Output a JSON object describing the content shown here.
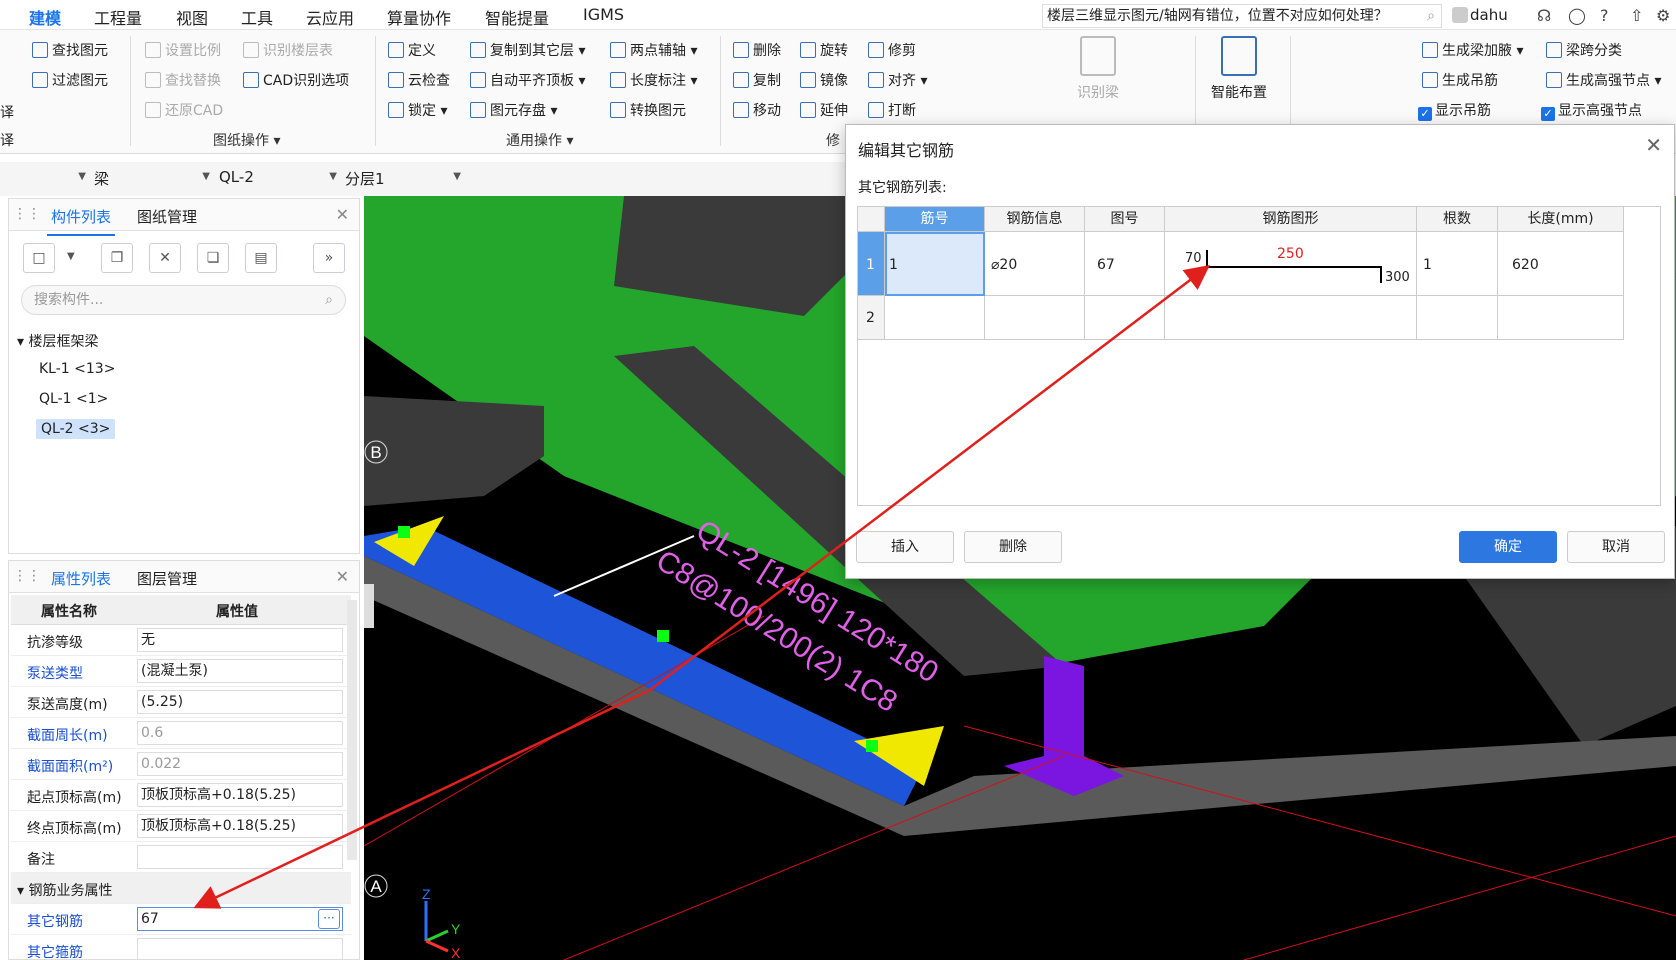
{
  "menu": {
    "items": [
      "建模",
      "工程量",
      "视图",
      "工具",
      "云应用",
      "算量协作",
      "智能提量",
      "IGMS"
    ],
    "active_index": 0,
    "question_text": "楼层三维显示图元/轴网有错位，位置不对应如何处理？",
    "user": "dahu"
  },
  "ribbon": {
    "left_cut": {
      "a": "译",
      "b": "译"
    },
    "g1": {
      "find": "查找图元",
      "filter": "过滤图元"
    },
    "g2": {
      "scale": "设置比例",
      "floor": "识别楼层表",
      "replace": "查找替换",
      "cad_opts": "CAD识别选项",
      "restore": "还原CAD",
      "label": "图纸操作"
    },
    "g3": {
      "define": "定义",
      "copy_to": "复制到其它层",
      "axis": "两点辅轴",
      "cloud_check": "云检查",
      "auto_flat": "自动平齐顶板",
      "length": "长度标注",
      "lock": "锁定",
      "store": "图元存盘",
      "convert": "转换图元",
      "label": "通用操作"
    },
    "g4": {
      "delete": "删除",
      "rotate": "旋转",
      "trim": "修剪",
      "copy": "复制",
      "mirror": "镜像",
      "align": "对齐",
      "move": "移动",
      "extend": "延伸",
      "break": "打断",
      "label": "修"
    },
    "g5": {
      "identify_beam": "识别梁",
      "smart_layout": "智能布置"
    },
    "g6": {
      "gen_haunch": "生成梁加腋",
      "span_class": "梁跨分类",
      "gen_hanger": "生成吊筋",
      "gen_hs_node": "生成高强节点",
      "show_hanger": "显示吊筋",
      "show_hs_node": "显示高强节点"
    }
  },
  "selectors": {
    "layer": "梁",
    "component": "QL-2",
    "sublayer": "分层1"
  },
  "comp_panel": {
    "tab_list": "构件列表",
    "tab_drawing": "图纸管理",
    "search_placeholder": "搜索构件...",
    "tree_root": "楼层框架梁",
    "items": [
      "KL-1 <13>",
      "QL-1 <1>",
      "QL-2 <3>"
    ],
    "selected_index": 2
  },
  "prop_panel": {
    "tab_attr": "属性列表",
    "tab_layer": "图层管理",
    "col_name": "属性名称",
    "col_value": "属性值",
    "rows": [
      {
        "name": "抗渗等级",
        "value": "无"
      },
      {
        "name": "泵送类型",
        "value": "(混凝土泵)"
      },
      {
        "name": "泵送高度(m)",
        "value": "(5.25)"
      },
      {
        "name": "截面周长(m)",
        "value": "0.6"
      },
      {
        "name": "截面面积(m²)",
        "value": "0.022"
      },
      {
        "name": "起点顶标高(m)",
        "value": "顶板顶标高+0.18(5.25)"
      },
      {
        "name": "终点顶标高(m)",
        "value": "顶板顶标高+0.18(5.25)"
      },
      {
        "name": "备注",
        "value": ""
      }
    ],
    "section": "钢筋业务属性",
    "other_rebar_name": "其它钢筋",
    "other_rebar_value": "67",
    "other_stirrup_name": "其它箍筋"
  },
  "dialog": {
    "title": "编辑其它钢筋",
    "subtitle": "其它钢筋列表:",
    "headers": [
      "筋号",
      "钢筋信息",
      "图号",
      "钢筋图形",
      "根数",
      "长度(mm)"
    ],
    "rows": [
      {
        "idx": "1",
        "bar_no": "1",
        "info": "⌀20",
        "fig": "67",
        "count": "1",
        "length": "620"
      },
      {
        "idx": "2",
        "bar_no": "",
        "info": "",
        "fig": "",
        "count": "",
        "length": ""
      }
    ],
    "shape": {
      "left": "70",
      "mid": "250",
      "right": "300"
    },
    "btn_insert": "插入",
    "btn_delete": "删除",
    "btn_ok": "确定",
    "btn_cancel": "取消"
  },
  "canvas": {
    "axis_b": "B",
    "axis_a": "A",
    "beam_text1": "QL-2 [1496] 120*180",
    "beam_text2": "C8@100/200(2) 1C8",
    "z": "Z",
    "y": "Y",
    "x": "X"
  }
}
